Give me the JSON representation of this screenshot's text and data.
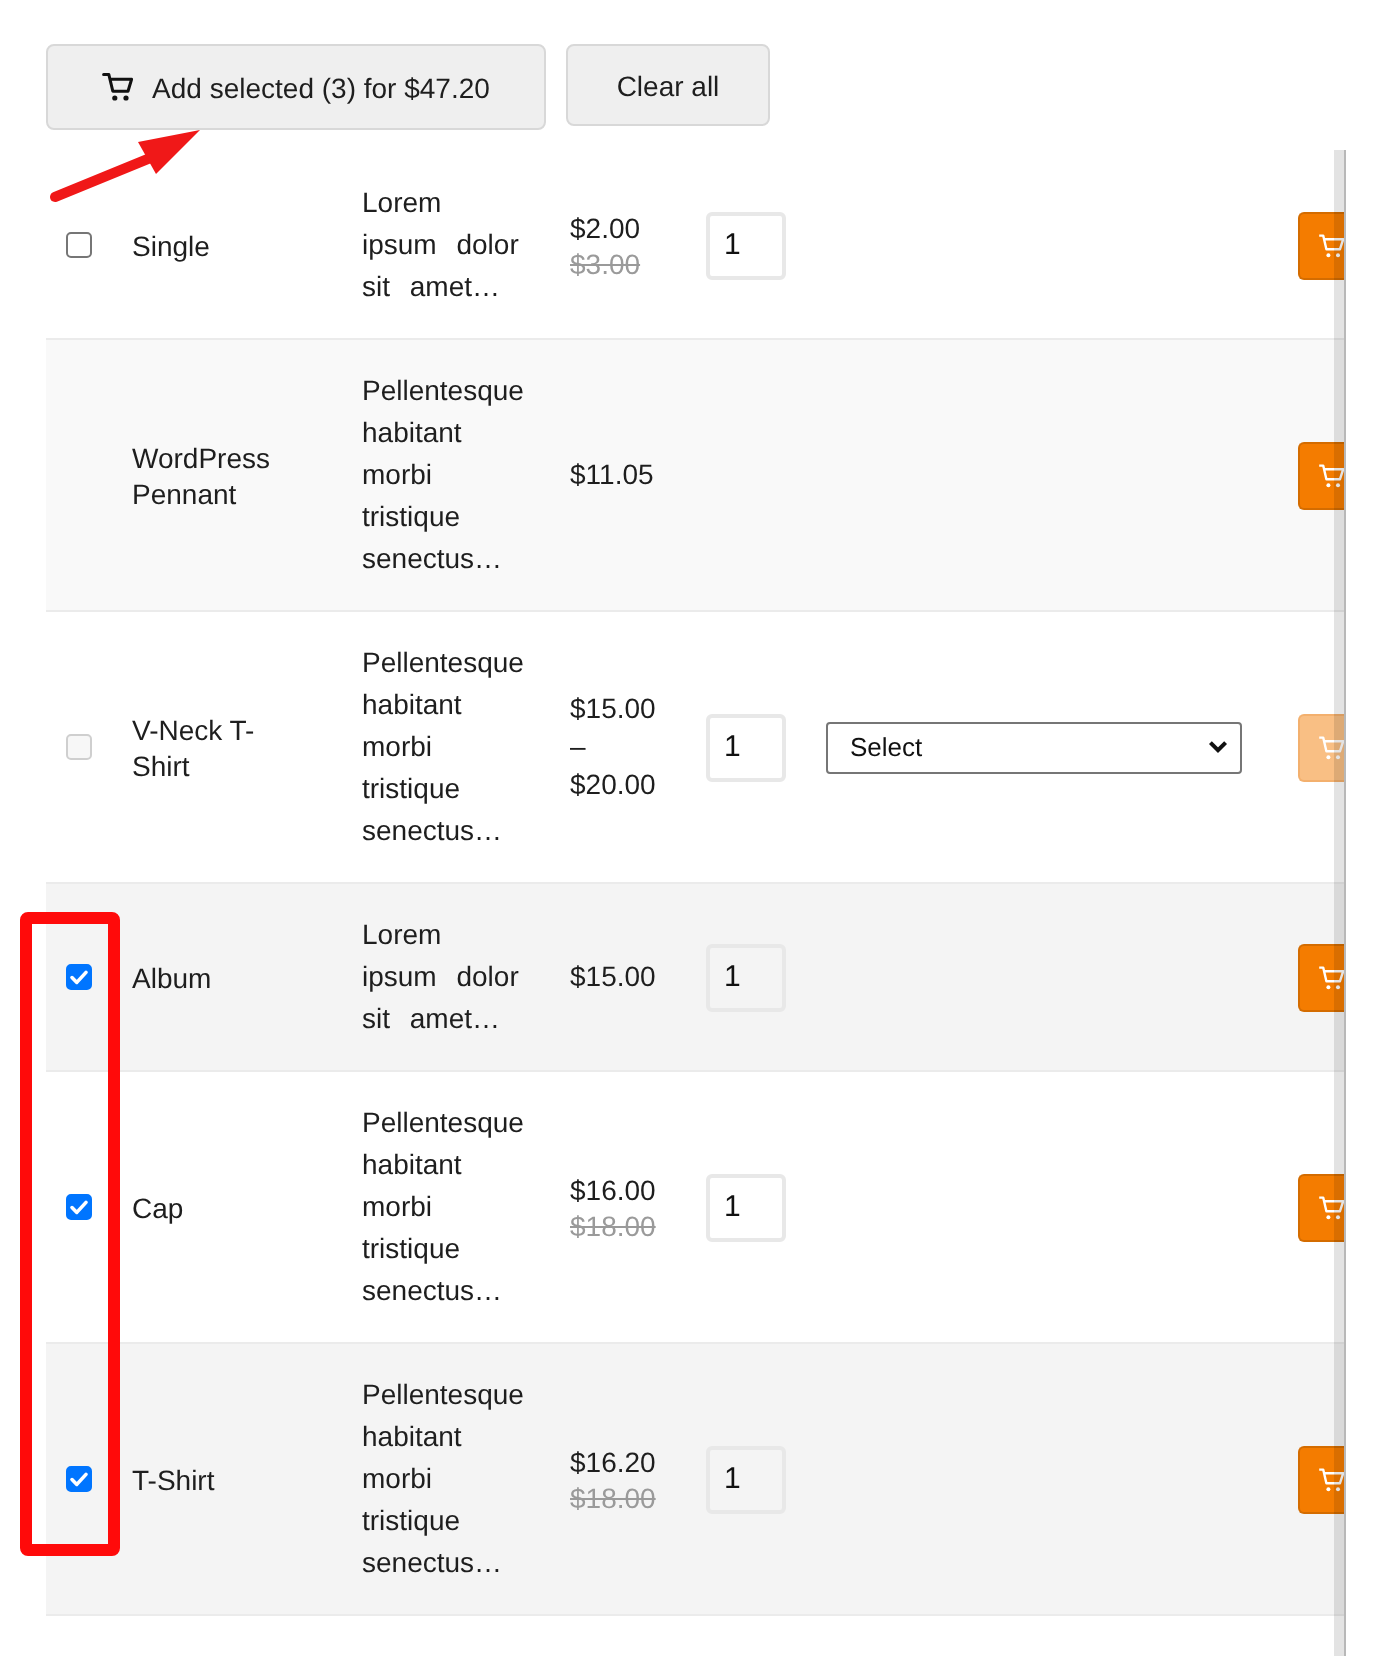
{
  "toolbar": {
    "add_selected_label": "Add selected (3) for $47.20",
    "clear_label": "Clear all"
  },
  "products": [
    {
      "checkbox": {
        "checked": false,
        "disabled": false
      },
      "name": "Single",
      "description": "Lorem ipsum dolor sit amet…",
      "price": "$2.00",
      "regular_price": "$3.00",
      "quantity": "1",
      "add_to_cart": {
        "disabled": false
      }
    },
    {
      "name": "WordPress Pennant",
      "description": "Pellentesque habitant morbi tristique senectus…",
      "price": "$11.05",
      "add_to_cart": {
        "disabled": false
      }
    },
    {
      "checkbox": {
        "checked": false,
        "disabled": true
      },
      "name": "V-Neck T-Shirt",
      "description": "Pellentesque habitant morbi tristique senectus…",
      "price": "$15.00 – $20.00",
      "quantity": "1",
      "variation_select": "Select",
      "add_to_cart": {
        "disabled": true
      }
    },
    {
      "checkbox": {
        "checked": true,
        "disabled": false
      },
      "name": "Album",
      "description": "Lorem ipsum dolor sit amet…",
      "price": "$15.00",
      "quantity": "1",
      "add_to_cart": {
        "disabled": false
      }
    },
    {
      "checkbox": {
        "checked": true,
        "disabled": false
      },
      "name": "Cap",
      "description": "Pellentesque habitant morbi tristique senectus…",
      "price": "$16.00",
      "regular_price": "$18.00",
      "quantity": "1",
      "add_to_cart": {
        "disabled": false
      }
    },
    {
      "checkbox": {
        "checked": true,
        "disabled": false
      },
      "name": "T-Shirt",
      "description": "Pellentesque habitant morbi tristique senectus…",
      "price": "$16.20",
      "regular_price": "$18.00",
      "quantity": "1",
      "add_to_cart": {
        "disabled": false
      }
    }
  ]
}
